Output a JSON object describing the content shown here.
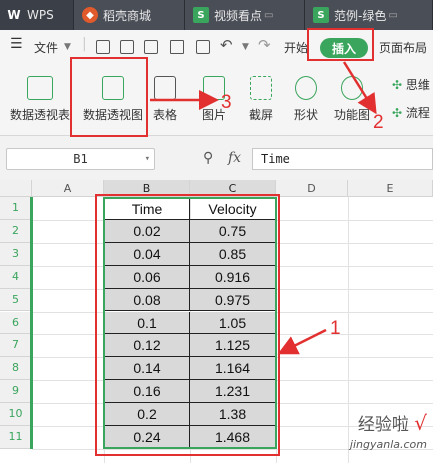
{
  "tabs": [
    {
      "label": "WPS",
      "icon": "wps-logo-icon"
    },
    {
      "label": "稻壳商城",
      "icon": "daoke-icon"
    },
    {
      "label": "视频看点",
      "icon": "sheet-doc-icon"
    },
    {
      "label": "范例-绿色",
      "icon": "sheet-doc-icon"
    }
  ],
  "menu": {
    "file_label": "文件",
    "start_label": "开始",
    "insert_label": "插入",
    "page_layout_label": "页面布局"
  },
  "toolbar": {
    "pivot_table": "数据透视表",
    "pivot_chart": "数据透视图",
    "table": "表格",
    "picture": "图片",
    "screenshot": "截屏",
    "shape": "形状",
    "function_chart": "功能图",
    "mindmap": "思维",
    "flowchart": "流程"
  },
  "formula_bar": {
    "name_box": "B1",
    "fx_label": "fx",
    "content": "Time"
  },
  "columns": [
    "A",
    "B",
    "C",
    "D",
    "E"
  ],
  "rows": [
    "1",
    "2",
    "3",
    "4",
    "5",
    "6",
    "7",
    "8",
    "9",
    "10",
    "11"
  ],
  "sheet": {
    "headers": [
      "Time",
      "Velocity"
    ],
    "data": [
      [
        "0.02",
        "0.75"
      ],
      [
        "0.04",
        "0.85"
      ],
      [
        "0.06",
        "0.916"
      ],
      [
        "0.08",
        "0.975"
      ],
      [
        "0.1",
        "1.05"
      ],
      [
        "0.12",
        "1.125"
      ],
      [
        "0.14",
        "1.164"
      ],
      [
        "0.16",
        "1.231"
      ],
      [
        "0.2",
        "1.38"
      ],
      [
        "0.24",
        "1.468"
      ]
    ]
  },
  "annotations": {
    "step1": "1",
    "step2": "2",
    "step3": "3",
    "color": "#e23030"
  },
  "watermark": {
    "main": "经验啦",
    "check": "√",
    "url": "jingyanla.com"
  },
  "colors": {
    "accent": "#3aa55d",
    "tabbar": "#3b3f48"
  }
}
